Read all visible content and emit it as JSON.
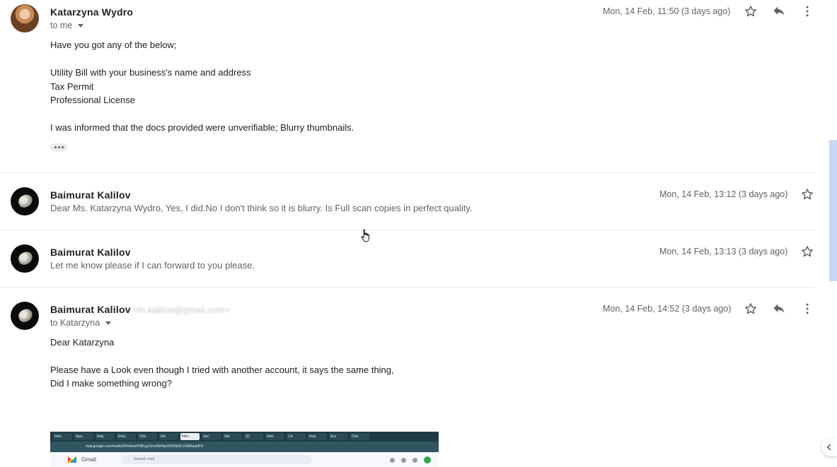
{
  "messages": [
    {
      "sender": "Katarzyna Wydro",
      "to": "to me",
      "date": "Mon, 14 Feb, 11:50 (3 days ago)",
      "body": [
        "Have you got any of the below;",
        "Utility Bill with your business's name and address",
        "Tax Permit",
        "Professional License",
        "I was informed that the docs provided were unverifiable; Blurry thumbnails."
      ]
    },
    {
      "sender": "Baimurat Kalilov",
      "date": "Mon, 14 Feb, 13:12 (3 days ago)",
      "snippet": "Dear Ms. Katarzyna Wydro, Yes, I did.No I don't think so it is blurry. Is Full scan copies in perfect quality."
    },
    {
      "sender": "Baimurat Kalilov",
      "date": "Mon, 14 Feb, 13:13 (3 days ago)",
      "snippet": "Let me know please if I can forward to you please."
    },
    {
      "sender": "Baimurat Kalilov",
      "sender_email": "<m.kalilov@gmail.com>",
      "to": "to Katarzyna",
      "date": "Mon, 14 Feb, 14:52 (3 days ago)",
      "body": [
        "Dear Katarzyna",
        "Please have a Look even though I tried with another account, it says the same thing,",
        "Did I make something wrong?"
      ]
    }
  ],
  "attachment": {
    "tabs": [
      "Inbo",
      "Inpu",
      "Indy",
      "Emu",
      "Cha",
      "Inb",
      "Inbo",
      "Sec",
      "Sta",
      "(2)",
      "Inbo",
      "Lin",
      "Insp",
      "Acc",
      "Cha"
    ],
    "url": "mail.google.com/mail/u/0/#inbox/FMfcgzGmvNkHtpxWSNbDLVsNtAsqhfHJ",
    "app_name": "Gmail",
    "search_placeholder": "Search mail",
    "avatar_letter": "B"
  },
  "icons": {
    "star": "star-icon",
    "reply": "reply-icon",
    "more": "more-vert-icon",
    "caret": "caret-down-icon",
    "expand": "ellipsis-icon",
    "side": "chevron-left-icon"
  },
  "colors": {
    "text_primary": "#202124",
    "text_secondary": "#5f6368",
    "divider": "#e8eaed",
    "scrollbar": "#c9d7f5"
  }
}
